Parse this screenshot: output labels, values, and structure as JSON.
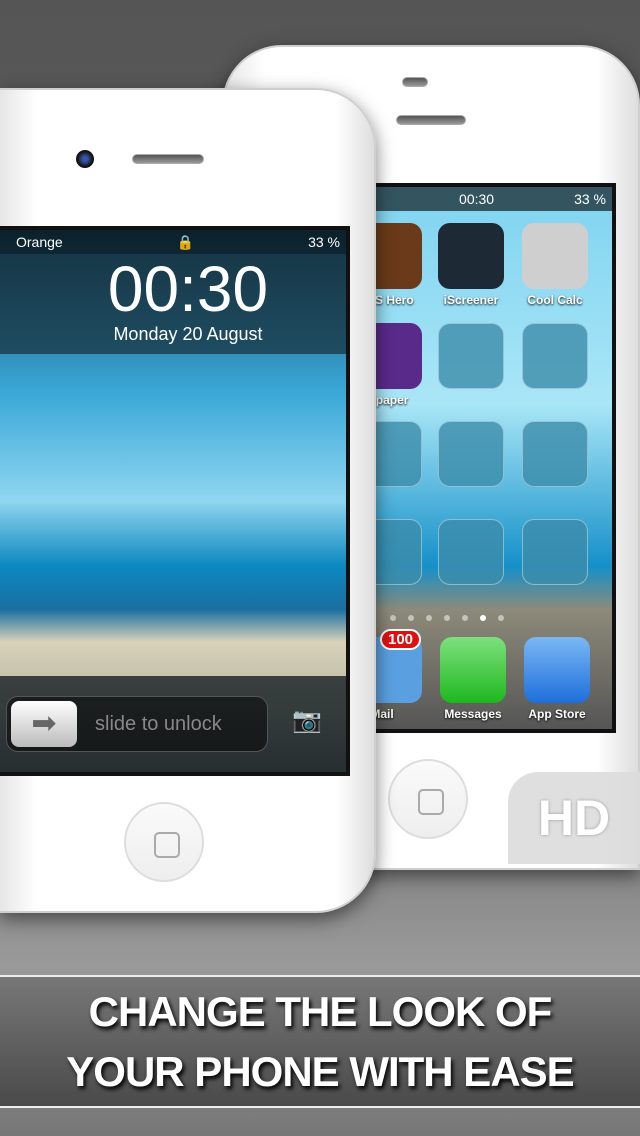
{
  "home_screen": {
    "time": "00:30",
    "battery": "33 %",
    "apps": [
      {
        "label": "iOS Hero",
        "color": "#6b3a1a"
      },
      {
        "label": "iScreener",
        "color": "#1d2a35"
      },
      {
        "label": "Cool Calc",
        "color": "#cfcfcf"
      },
      {
        "label": "Wallpaper",
        "color": "#5a2a8a"
      }
    ],
    "dock": [
      {
        "label": "Mail",
        "color": "#5aa0e0",
        "badge": "100"
      },
      {
        "label": "Messages",
        "color": "#2ec82e"
      },
      {
        "label": "App Store",
        "color": "#1e6fdc"
      }
    ],
    "page_count": 7,
    "current_page": 6
  },
  "lock_screen": {
    "carrier": "Orange",
    "battery": "33 %",
    "time": "00:30",
    "date": "Monday 20 August",
    "slider_text": "slide to unlock"
  },
  "badge_hd": "HD",
  "banner": {
    "line1": "CHANGE THE LOOK OF",
    "line2": "YOUR PHONE WITH EASE"
  }
}
